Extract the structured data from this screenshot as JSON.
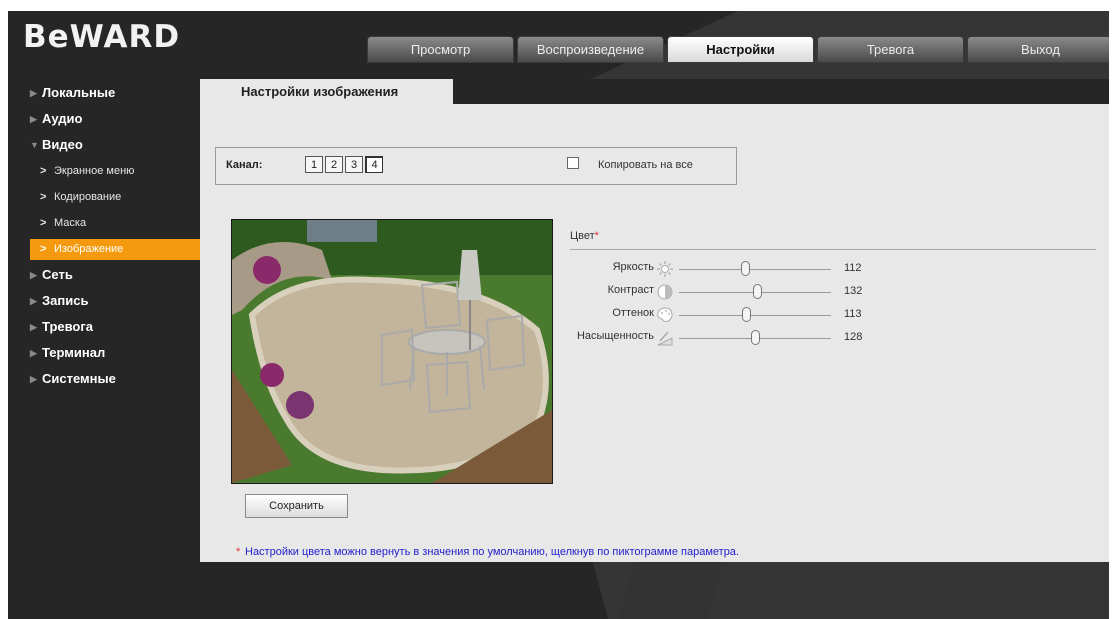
{
  "brand": {
    "logo_text": "BeWARD"
  },
  "nav": {
    "tabs": [
      {
        "label": "Просмотр",
        "active": false
      },
      {
        "label": "Воспроизведение",
        "active": false
      },
      {
        "label": "Настройки",
        "active": true
      },
      {
        "label": "Тревога",
        "active": false
      },
      {
        "label": "Выход",
        "active": false
      }
    ]
  },
  "sidebar": {
    "items": [
      {
        "label": "Локальные"
      },
      {
        "label": "Аудио"
      },
      {
        "label": "Видео",
        "expanded": true
      },
      {
        "label": "Экранное меню"
      },
      {
        "label": "Кодирование"
      },
      {
        "label": "Маска"
      },
      {
        "label": "Изображение",
        "active": true
      },
      {
        "label": "Сеть"
      },
      {
        "label": "Запись"
      },
      {
        "label": "Тревога"
      },
      {
        "label": "Терминал"
      },
      {
        "label": "Системные"
      }
    ]
  },
  "page": {
    "tab_title": "Настройки изображения",
    "channel": {
      "label": "Канал:",
      "buttons": [
        "1",
        "2",
        "3",
        "4"
      ],
      "selected": "4",
      "copy_all_label": "Копировать на все",
      "copy_all_checked": false
    },
    "color": {
      "title": "Цвет",
      "required_mark": "*",
      "sliders": [
        {
          "label": "Яркость",
          "icon": "brightness-icon",
          "value": "112",
          "value_num": 112
        },
        {
          "label": "Контраст",
          "icon": "contrast-icon",
          "value": "132",
          "value_num": 132
        },
        {
          "label": "Оттенок",
          "icon": "hue-icon",
          "value": "113",
          "value_num": 113
        },
        {
          "label": "Насыщенность",
          "icon": "saturation-icon",
          "value": "128",
          "value_num": 128
        }
      ],
      "slider_max": 255
    },
    "save_label": "Сохранить",
    "note_mark": "*",
    "note": "Настройки цвета можно вернуть в значения по умолчанию, щелкнув по пиктограмме параметра."
  },
  "colors": {
    "accent": "#f59a0f",
    "background": "#262626",
    "panel": "#e8e8e8",
    "note": "#2222cc"
  }
}
